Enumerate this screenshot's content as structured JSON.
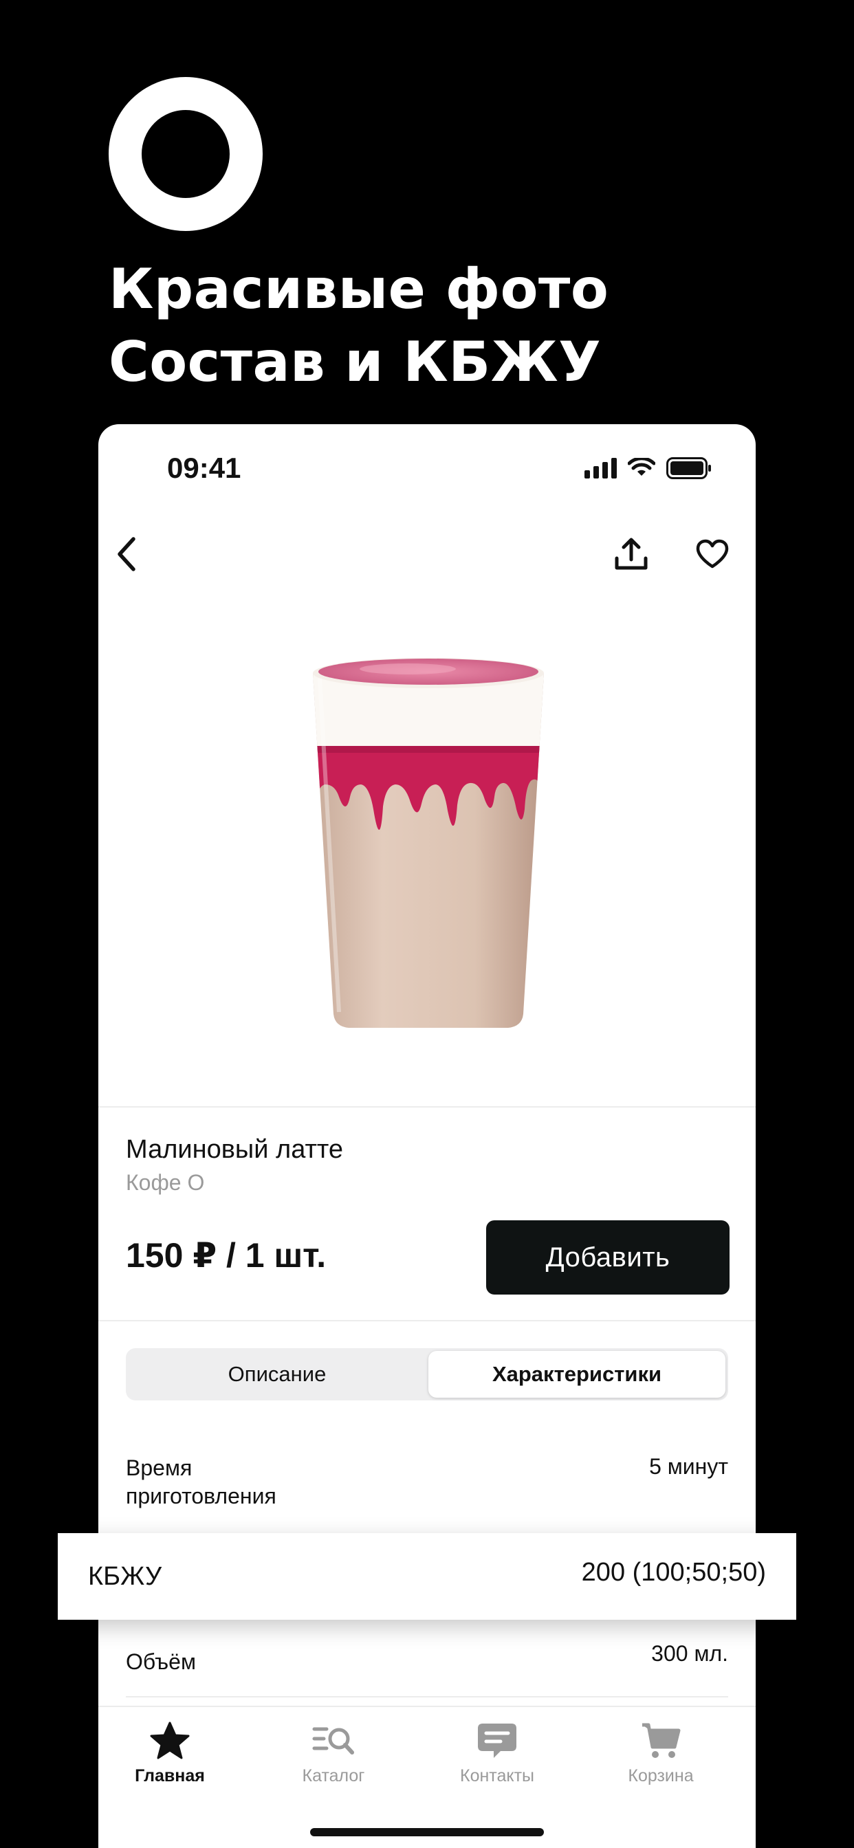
{
  "promo": {
    "headline_line1": "Красивые фото",
    "headline_line2": "Состав и КБЖУ"
  },
  "status_bar": {
    "time": "09:41"
  },
  "product": {
    "name": "Малиновый латте",
    "brand": "Кофе О",
    "price": "150 ₽ / 1 шт.",
    "add_label": "Добавить"
  },
  "tabs": {
    "description": "Описание",
    "characteristics": "Характеристики",
    "active": "characteristics"
  },
  "specs": {
    "prep_time_label_line1": "Время",
    "prep_time_label_line2": "приготовления",
    "prep_time_value": "5 минут",
    "kbju_label": "КБЖУ",
    "kbju_value": "200 (100;50;50)",
    "volume_label": "Объём",
    "volume_value": "300 мл."
  },
  "tab_bar": {
    "items": [
      {
        "label": "Главная",
        "icon": "star-icon",
        "active": true
      },
      {
        "label": "Каталог",
        "icon": "catalog-search-icon",
        "active": false
      },
      {
        "label": "Контакты",
        "icon": "chat-icon",
        "active": false
      },
      {
        "label": "Корзина",
        "icon": "cart-icon",
        "active": false
      }
    ]
  },
  "colors": {
    "background": "#000000",
    "button": "#0f1313",
    "inactive": "#9a9a9a",
    "raspberry": "#d62a62"
  }
}
